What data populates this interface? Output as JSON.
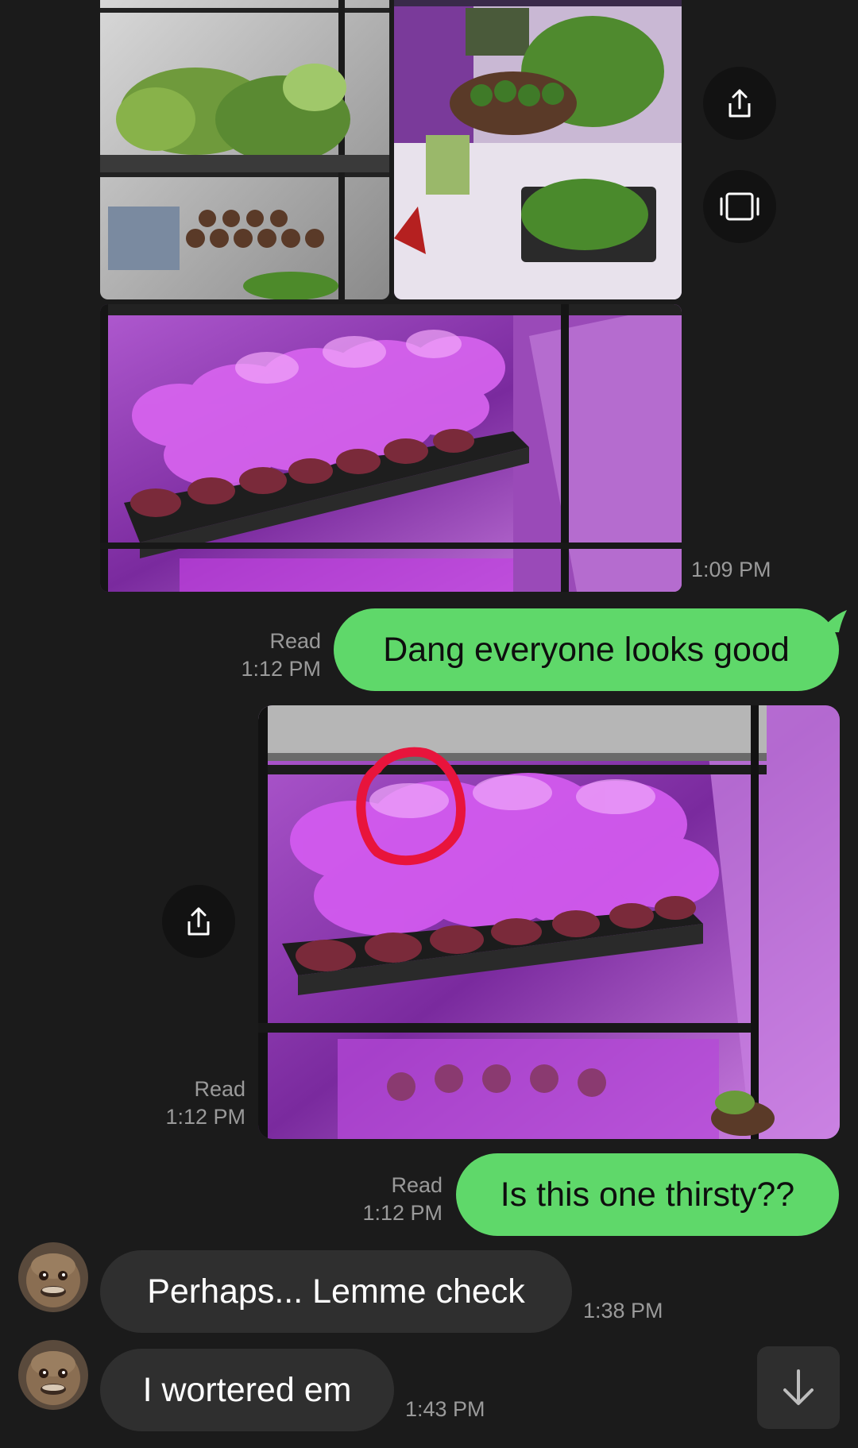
{
  "conversation": {
    "photo_group": {
      "timestamp": "1:09 PM",
      "share_icon": "share-icon",
      "gallery_icon": "gallery-icon"
    },
    "messages": [
      {
        "id": "m1",
        "direction": "outgoing",
        "text": "Dang everyone looks good",
        "status": "Read",
        "time": "1:12 PM"
      },
      {
        "id": "m2",
        "direction": "outgoing",
        "type": "image",
        "status": "Read",
        "time": "1:12 PM",
        "share_icon": "share-icon"
      },
      {
        "id": "m3",
        "direction": "outgoing",
        "text": "Is this one thirsty??",
        "status": "Read",
        "time": "1:12 PM"
      },
      {
        "id": "m4",
        "direction": "incoming",
        "text": "Perhaps... Lemme check",
        "time": "1:38 PM",
        "avatar": "contact-avatar"
      },
      {
        "id": "m5",
        "direction": "incoming",
        "text": "I wortered em",
        "time": "1:43 PM",
        "avatar": "contact-avatar"
      }
    ],
    "scroll_down_icon": "arrow-down-icon"
  },
  "colors": {
    "background": "#1b1b1b",
    "outgoing_bubble": "#5fd86a",
    "incoming_bubble": "#2f2f2f",
    "timestamp_text": "#9a9a9a",
    "grow_light": "#c03cf0",
    "annotation_circle": "#e8143c"
  }
}
